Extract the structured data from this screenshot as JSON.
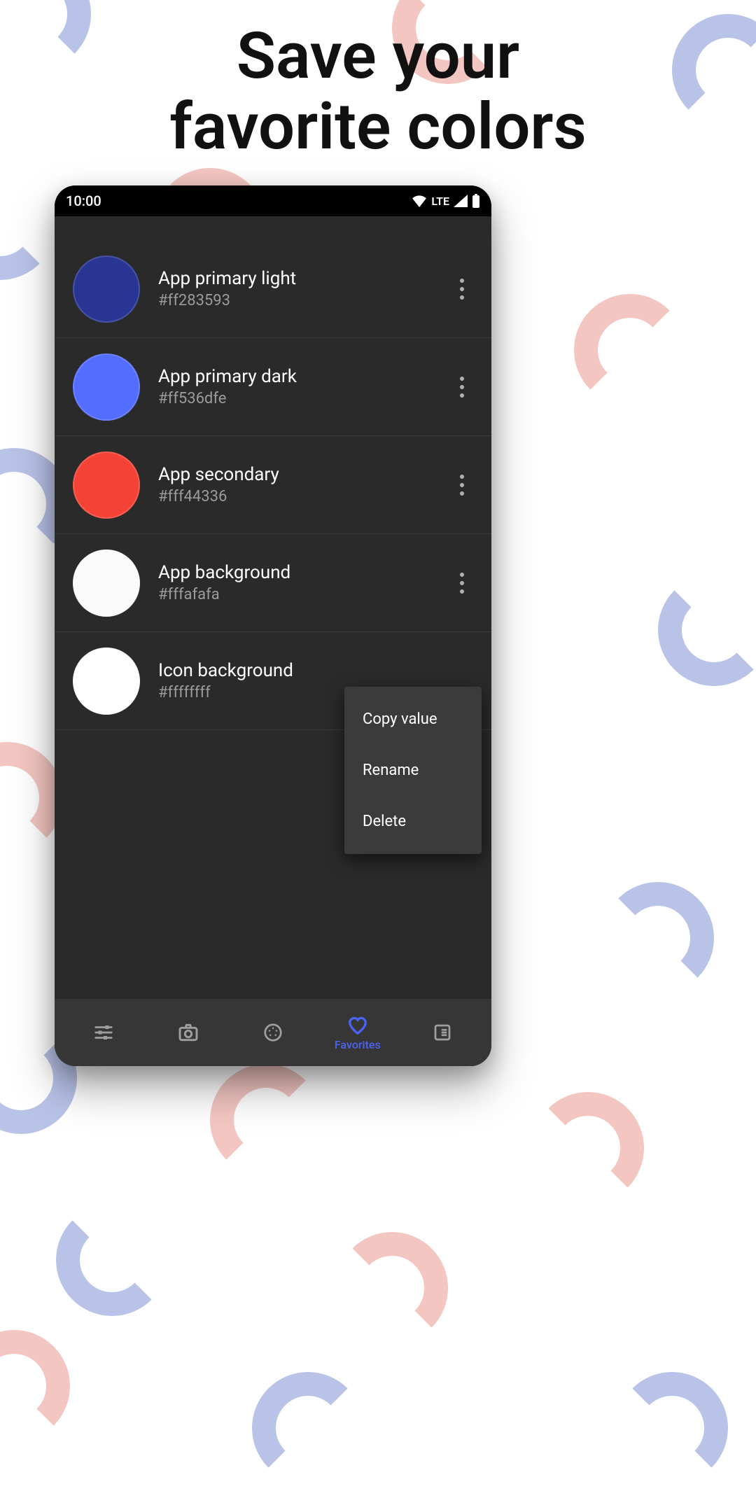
{
  "promo": {
    "title_line1": "Save your",
    "title_line2": "favorite colors"
  },
  "statusbar": {
    "time": "10:00",
    "network": "LTE"
  },
  "colors": [
    {
      "name": "App primary light",
      "code": "#ff283593",
      "swatch": "#283593"
    },
    {
      "name": "App primary dark",
      "code": "#ff536dfe",
      "swatch": "#536dfe"
    },
    {
      "name": "App secondary",
      "code": "#fff44336",
      "swatch": "#f44336"
    },
    {
      "name": "App background",
      "code": "#fffafafa",
      "swatch": "#fafafa"
    },
    {
      "name": "Icon background",
      "code": "#ffffffff",
      "swatch": "#ffffff"
    }
  ],
  "menu": {
    "copy": "Copy value",
    "rename": "Rename",
    "delete": "Delete"
  },
  "nav": {
    "favorites_label": "Favorites",
    "active_color": "#4a64f6",
    "inactive_color": "#9e9e9e"
  }
}
